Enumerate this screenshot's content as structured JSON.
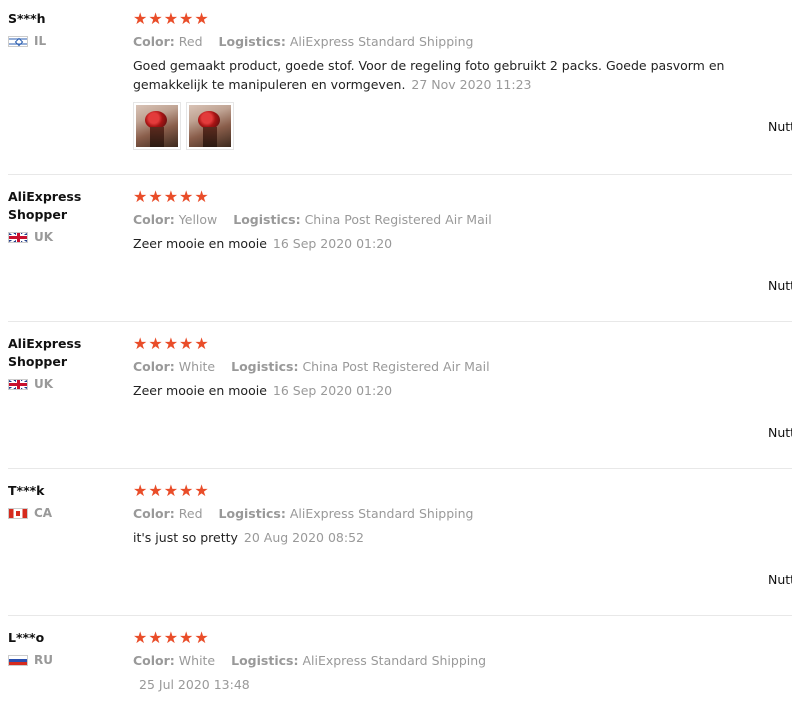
{
  "reviews": [
    {
      "user": "S***h",
      "country": "IL",
      "rating": 5,
      "color_label": "Color:",
      "color": "Red",
      "logistics_label": "Logistics:",
      "logistics": "AliExpress Standard Shipping",
      "text": "Goed gemaakt product, goede stof. Voor de regeling foto gebruikt 2 packs. Goede pasvorm en gemakkelijk te manipuleren en vormgeven.",
      "date": "27 Nov 2020 11:23",
      "photos": 2,
      "helpful": "Nuttig"
    },
    {
      "user": "AliExpress Shopper",
      "country": "UK",
      "rating": 5,
      "color_label": "Color:",
      "color": "Yellow",
      "logistics_label": "Logistics:",
      "logistics": "China Post Registered Air Mail",
      "text": "Zeer mooie en mooie",
      "date": "16 Sep 2020 01:20",
      "photos": 0,
      "helpful": "Nuttig"
    },
    {
      "user": "AliExpress Shopper",
      "country": "UK",
      "rating": 5,
      "color_label": "Color:",
      "color": "White",
      "logistics_label": "Logistics:",
      "logistics": "China Post Registered Air Mail",
      "text": "Zeer mooie en mooie",
      "date": "16 Sep 2020 01:20",
      "photos": 0,
      "helpful": "Nuttig"
    },
    {
      "user": "T***k",
      "country": "CA",
      "rating": 5,
      "color_label": "Color:",
      "color": "Red",
      "logistics_label": "Logistics:",
      "logistics": "AliExpress Standard Shipping",
      "text": "it's just so pretty",
      "date": "20 Aug 2020 08:52",
      "photos": 0,
      "helpful": "Nuttig"
    },
    {
      "user": "L***o",
      "country": "RU",
      "rating": 5,
      "color_label": "Color:",
      "color": "White",
      "logistics_label": "Logistics:",
      "logistics": "AliExpress Standard Shipping",
      "text": "",
      "date": "25 Jul 2020 13:48",
      "photos": 0,
      "helpful": ""
    }
  ],
  "icons": {
    "star": "star-icon",
    "star_color": "#e62e04"
  }
}
